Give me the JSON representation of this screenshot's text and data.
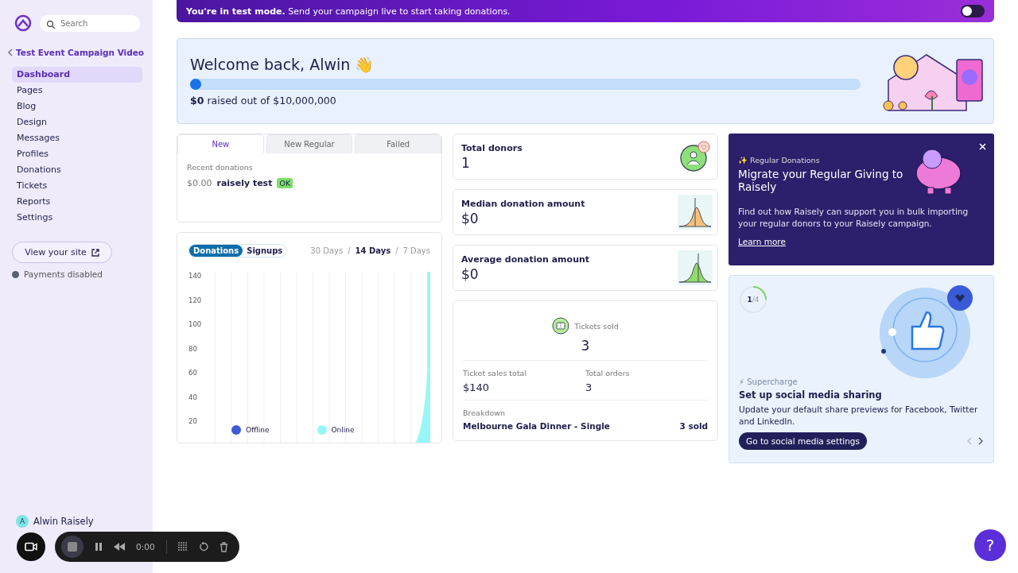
{
  "sidebar": {
    "search": {
      "placeholder": "Search"
    },
    "back": "Test Event Campaign Video",
    "nav": [
      {
        "label": "Dashboard",
        "selected": true
      },
      {
        "label": "Pages",
        "selected": false
      },
      {
        "label": "Blog",
        "selected": false
      },
      {
        "label": "Design",
        "selected": false
      },
      {
        "label": "Messages",
        "selected": false
      },
      {
        "label": "Profiles",
        "selected": false
      },
      {
        "label": "Donations",
        "selected": false
      },
      {
        "label": "Tickets",
        "selected": false
      },
      {
        "label": "Reports",
        "selected": false
      },
      {
        "label": "Settings",
        "selected": false
      }
    ],
    "view_site": "View your site",
    "payments": "Payments disabled",
    "user": {
      "initial": "A",
      "name": "Alwin Raisely"
    }
  },
  "banner": {
    "text": "**You're in test mode.** Send your campaign live to start taking donations.",
    "on": false
  },
  "welcome": {
    "title": "Welcome back, Alwin 👋",
    "level": 0,
    "raised": "**$0** raised out of $10,000,000"
  },
  "donation_tabs": [
    {
      "label": "New",
      "selected": true
    },
    {
      "label": "New Regular",
      "selected": false
    },
    {
      "label": "Failed",
      "selected": false
    }
  ],
  "recent": {
    "label": "Recent donations",
    "items": [
      {
        "amount": "$0.00",
        "name": "raisely test",
        "status": "OK"
      }
    ]
  },
  "chart": {
    "toggles": [
      {
        "label": "Donations",
        "selected": true
      },
      {
        "label": "Signups",
        "selected": false
      }
    ],
    "separator": "/",
    "ranges": [
      {
        "label": "30 Days",
        "selected": false
      },
      {
        "label": "14 Days",
        "selected": true
      },
      {
        "label": "7 Days",
        "selected": false
      }
    ],
    "y_ticks": [
      "140",
      "120",
      "100",
      "80",
      "60",
      "40",
      "20"
    ],
    "legend": [
      {
        "label": "Offline",
        "color": "#3b5bdb"
      },
      {
        "label": "Online",
        "color": "#99f6f6"
      }
    ]
  },
  "stats": [
    {
      "kind": "donors",
      "label": "Total donors",
      "value": "1"
    },
    {
      "kind": "median",
      "label": "Median donation amount",
      "value": "$0"
    },
    {
      "kind": "average",
      "label": "Average donation amount",
      "value": "$0"
    }
  ],
  "tickets": {
    "label": "Tickets sold",
    "value": "3",
    "sales_label": "Ticket sales total",
    "sales_value": "$140",
    "orders_label": "Total orders",
    "orders_value": "3",
    "breakdown_label": "Breakdown",
    "items": [
      {
        "name": "Melbourne Gala Dinner - Single",
        "sold": "3 sold"
      }
    ]
  },
  "promo": {
    "tag": "✨ Regular Donations",
    "title": "Migrate your Regular Giving to Raisely",
    "text": "Find out how Raisely can support you in bulk importing your regular donors to your Raisely campaign.",
    "link": "Learn more"
  },
  "task": {
    "step": "1",
    "total": "/4",
    "level": 0.25,
    "tag": "⚡ Supercharge",
    "title": "Set up social media sharing",
    "text": "Update your default share previews for Facebook, Twitter and LinkedIn.",
    "button": "Go to social media settings"
  },
  "recorder": {
    "time": "0:00"
  },
  "help": "?"
}
